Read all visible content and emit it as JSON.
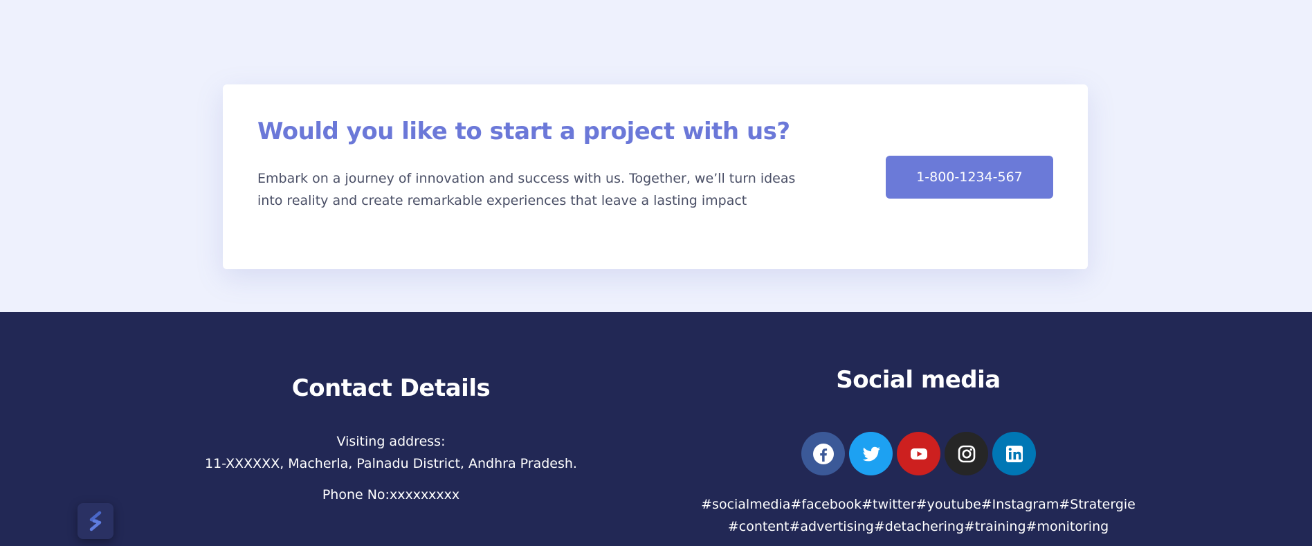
{
  "cta": {
    "title": "Would you like to start a project with us?",
    "text": "Embark on a journey of innovation and success with us. Together, we’ll turn ideas into reality and create remarkable experiences that leave a lasting impact",
    "button_label": "1-800-1234-567"
  },
  "contact": {
    "heading": "Contact Details",
    "address_label": "Visiting address:",
    "address": "11-XXXXXX, Macherla, Palnadu District, Andhra Pradesh.",
    "phone": "Phone No:xxxxxxxxx"
  },
  "social": {
    "heading": "Social media",
    "icons": [
      {
        "name": "facebook-icon",
        "color": "#3b5998"
      },
      {
        "name": "twitter-icon",
        "color": "#1da1f2"
      },
      {
        "name": "youtube-icon",
        "color": "#cd201f"
      },
      {
        "name": "instagram-icon",
        "color": "#262626"
      },
      {
        "name": "linkedin-icon",
        "color": "#0077b5"
      }
    ],
    "hashtags_line1": "#socialmedia#facebook#twitter#youtube#Instagram#Stratergie",
    "hashtags_line2": "#content#advertising#detachering#training#monitoring"
  },
  "colors": {
    "page_bg": "#eef1fd",
    "accent": "#6b78d8",
    "footer_bg": "#222855"
  }
}
